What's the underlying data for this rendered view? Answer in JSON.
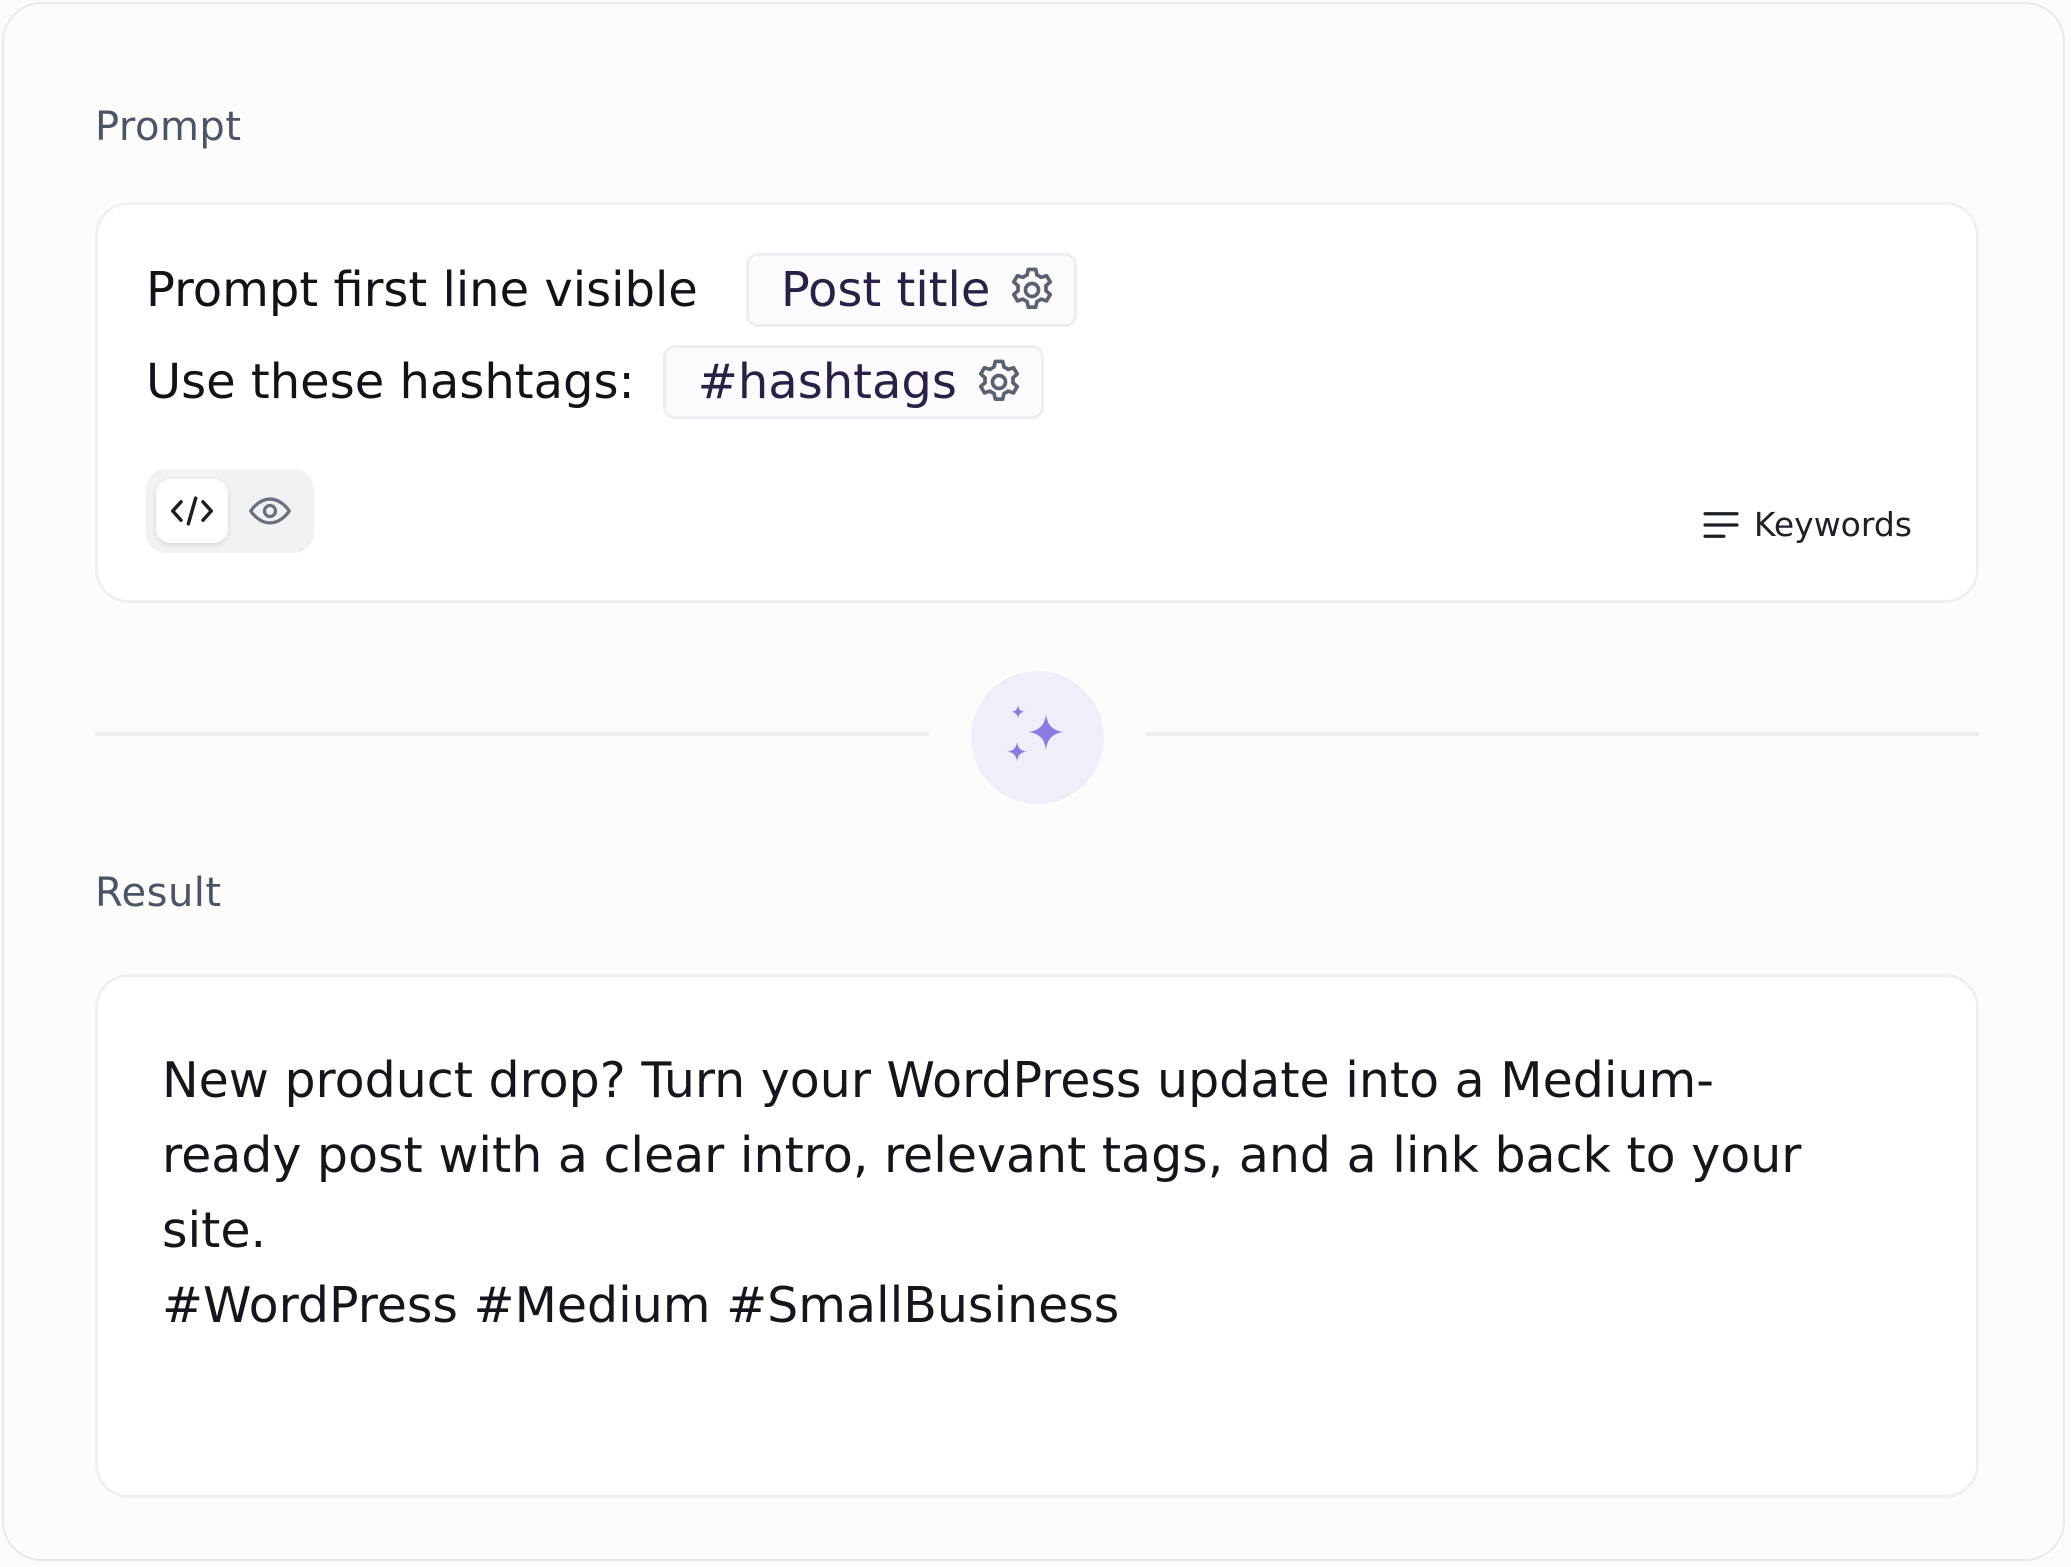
{
  "prompt": {
    "label": "Prompt",
    "lines": [
      {
        "text": "Prompt first line visible",
        "chip": "Post title"
      },
      {
        "text": "Use these hashtags:",
        "chip": "#hashtags"
      }
    ],
    "keywords_label": "Keywords"
  },
  "result": {
    "label": "Result",
    "body": "New product drop? Turn your WordPress update into a Medium-\nready post with a clear intro, relevant tags, and a link back to your\nsite.\n#WordPress #Medium #SmallBusiness"
  },
  "icons": {
    "chip_settings": "gear-icon",
    "code_view": "code-icon",
    "preview": "eye-icon",
    "keywords": "lines-icon",
    "generate": "sparkles-icon"
  },
  "colors": {
    "accent": "#8b7be0",
    "accent_bg": "#f1eefb"
  }
}
